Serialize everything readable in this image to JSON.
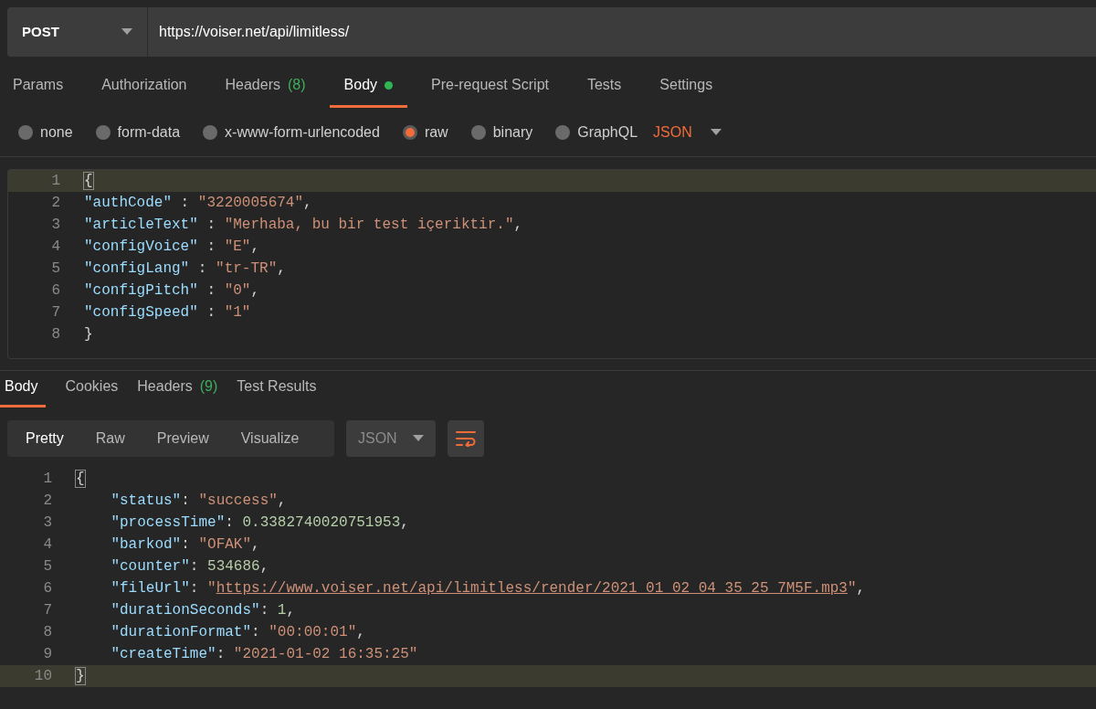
{
  "request": {
    "method": "POST",
    "url": "https://voiser.net/api/limitless/"
  },
  "request_tabs": [
    {
      "label": "Params",
      "selected": false
    },
    {
      "label": "Authorization",
      "selected": false
    },
    {
      "label": "Headers",
      "count": "(8)",
      "selected": false
    },
    {
      "label": "Body",
      "has_content": true,
      "selected": true
    },
    {
      "label": "Pre-request Script",
      "selected": false
    },
    {
      "label": "Tests",
      "selected": false
    },
    {
      "label": "Settings",
      "selected": false
    }
  ],
  "body_types": [
    {
      "label": "none",
      "selected": false
    },
    {
      "label": "form-data",
      "selected": false
    },
    {
      "label": "x-www-form-urlencoded",
      "selected": false
    },
    {
      "label": "raw",
      "selected": true
    },
    {
      "label": "binary",
      "selected": false
    },
    {
      "label": "GraphQL",
      "selected": false
    }
  ],
  "body_format": "JSON",
  "request_body": [
    {
      "number": "1",
      "highlighted": true,
      "tokens": [
        {
          "kind": "brace",
          "text": "{"
        }
      ]
    },
    {
      "number": "2",
      "highlighted": false,
      "tokens": [
        {
          "kind": "key",
          "text": "\"authCode\""
        },
        {
          "kind": "punct",
          "text": " : "
        },
        {
          "kind": "string",
          "text": "\"3220005674\""
        },
        {
          "kind": "punct",
          "text": ","
        }
      ]
    },
    {
      "number": "3",
      "highlighted": false,
      "tokens": [
        {
          "kind": "key",
          "text": "\"articleText\""
        },
        {
          "kind": "punct",
          "text": " : "
        },
        {
          "kind": "string",
          "text": "\"Merhaba, bu bir test içeriktir.\""
        },
        {
          "kind": "punct",
          "text": ","
        }
      ]
    },
    {
      "number": "4",
      "highlighted": false,
      "tokens": [
        {
          "kind": "key",
          "text": "\"configVoice\""
        },
        {
          "kind": "punct",
          "text": " : "
        },
        {
          "kind": "string",
          "text": "\"E\""
        },
        {
          "kind": "punct",
          "text": ","
        }
      ]
    },
    {
      "number": "5",
      "highlighted": false,
      "tokens": [
        {
          "kind": "key",
          "text": "\"configLang\""
        },
        {
          "kind": "punct",
          "text": " : "
        },
        {
          "kind": "string",
          "text": "\"tr-TR\""
        },
        {
          "kind": "punct",
          "text": ","
        }
      ]
    },
    {
      "number": "6",
      "highlighted": false,
      "tokens": [
        {
          "kind": "key",
          "text": "\"configPitch\""
        },
        {
          "kind": "punct",
          "text": " : "
        },
        {
          "kind": "string",
          "text": "\"0\""
        },
        {
          "kind": "punct",
          "text": ","
        }
      ]
    },
    {
      "number": "7",
      "highlighted": false,
      "tokens": [
        {
          "kind": "key",
          "text": "\"configSpeed\""
        },
        {
          "kind": "punct",
          "text": " : "
        },
        {
          "kind": "string",
          "text": "\"1\""
        }
      ]
    },
    {
      "number": "8",
      "highlighted": false,
      "tokens": [
        {
          "kind": "brace",
          "text": "}"
        }
      ]
    }
  ],
  "response_tabs": [
    {
      "label": "Body",
      "selected": true
    },
    {
      "label": "Cookies",
      "selected": false
    },
    {
      "label": "Headers",
      "count": "(9)",
      "selected": false
    },
    {
      "label": "Test Results",
      "selected": false
    }
  ],
  "view_modes": [
    {
      "label": "Pretty",
      "selected": true
    },
    {
      "label": "Raw",
      "selected": false
    },
    {
      "label": "Preview",
      "selected": false
    },
    {
      "label": "Visualize",
      "selected": false
    }
  ],
  "response_format": "JSON",
  "response_body": [
    {
      "number": "1",
      "highlighted": false,
      "tokens": [
        {
          "kind": "brace",
          "text": "{"
        }
      ]
    },
    {
      "number": "2",
      "highlighted": false,
      "tokens": [
        {
          "kind": "key",
          "text": "    \"status\""
        },
        {
          "kind": "punct",
          "text": ": "
        },
        {
          "kind": "string",
          "text": "\"success\""
        },
        {
          "kind": "punct",
          "text": ","
        }
      ]
    },
    {
      "number": "3",
      "highlighted": false,
      "tokens": [
        {
          "kind": "key",
          "text": "    \"processTime\""
        },
        {
          "kind": "punct",
          "text": ": "
        },
        {
          "kind": "number",
          "text": "0.3382740020751953"
        },
        {
          "kind": "punct",
          "text": ","
        }
      ]
    },
    {
      "number": "4",
      "highlighted": false,
      "tokens": [
        {
          "kind": "key",
          "text": "    \"barkod\""
        },
        {
          "kind": "punct",
          "text": ": "
        },
        {
          "kind": "string",
          "text": "\"OFAK\""
        },
        {
          "kind": "punct",
          "text": ","
        }
      ]
    },
    {
      "number": "5",
      "highlighted": false,
      "tokens": [
        {
          "kind": "key",
          "text": "    \"counter\""
        },
        {
          "kind": "punct",
          "text": ": "
        },
        {
          "kind": "number",
          "text": "534686"
        },
        {
          "kind": "punct",
          "text": ","
        }
      ]
    },
    {
      "number": "6",
      "highlighted": false,
      "tokens": [
        {
          "kind": "key",
          "text": "    \"fileUrl\""
        },
        {
          "kind": "punct",
          "text": ": "
        },
        {
          "kind": "string",
          "text": "\""
        },
        {
          "kind": "link",
          "text": "https://www.voiser.net/api/limitless/render/2021_01_02_04_35_25_7M5F.mp3"
        },
        {
          "kind": "string",
          "text": "\""
        },
        {
          "kind": "punct",
          "text": ","
        }
      ]
    },
    {
      "number": "7",
      "highlighted": false,
      "tokens": [
        {
          "kind": "key",
          "text": "    \"durationSeconds\""
        },
        {
          "kind": "punct",
          "text": ": "
        },
        {
          "kind": "number",
          "text": "1"
        },
        {
          "kind": "punct",
          "text": ","
        }
      ]
    },
    {
      "number": "8",
      "highlighted": false,
      "tokens": [
        {
          "kind": "key",
          "text": "    \"durationFormat\""
        },
        {
          "kind": "punct",
          "text": ": "
        },
        {
          "kind": "string",
          "text": "\"00:00:01\""
        },
        {
          "kind": "punct",
          "text": ","
        }
      ]
    },
    {
      "number": "9",
      "highlighted": false,
      "tokens": [
        {
          "kind": "key",
          "text": "    \"createTime\""
        },
        {
          "kind": "punct",
          "text": ": "
        },
        {
          "kind": "string",
          "text": "\"2021-01-02 16:35:25\""
        }
      ]
    },
    {
      "number": "10",
      "highlighted": true,
      "tokens": [
        {
          "kind": "brace",
          "text": "}"
        }
      ]
    }
  ]
}
